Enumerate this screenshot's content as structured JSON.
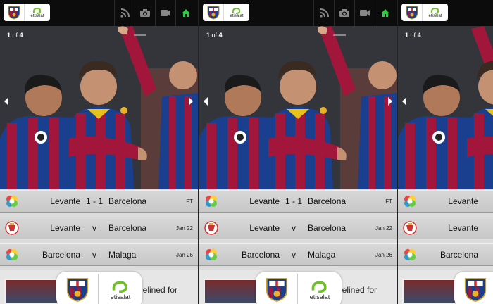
{
  "header": {
    "brand_text": "etisalat",
    "icons": [
      "rss-icon",
      "camera-icon",
      "video-icon",
      "home-icon"
    ],
    "home_color": "#2ecc40"
  },
  "gallery": {
    "current": "1",
    "of_label": "of",
    "total": "4"
  },
  "matches": [
    {
      "league": "laliga-icon",
      "home": "Levante",
      "score": "1 - 1",
      "away": "Barcelona",
      "status": "FT"
    },
    {
      "league": "copa-del-rey-icon",
      "home": "Levante",
      "score": "v",
      "away": "Barcelona",
      "status": "Jan 22"
    },
    {
      "league": "laliga-icon",
      "home": "Barcelona",
      "score": "v",
      "away": "Malaga",
      "status": "Jan 26"
    }
  ],
  "promo": {
    "text": "lelined for",
    "brand_text": "etisalat"
  },
  "colors": {
    "club_blue": "#1a3f8f",
    "club_red": "#a3163b",
    "etisalat_green": "#6fbf2a"
  }
}
